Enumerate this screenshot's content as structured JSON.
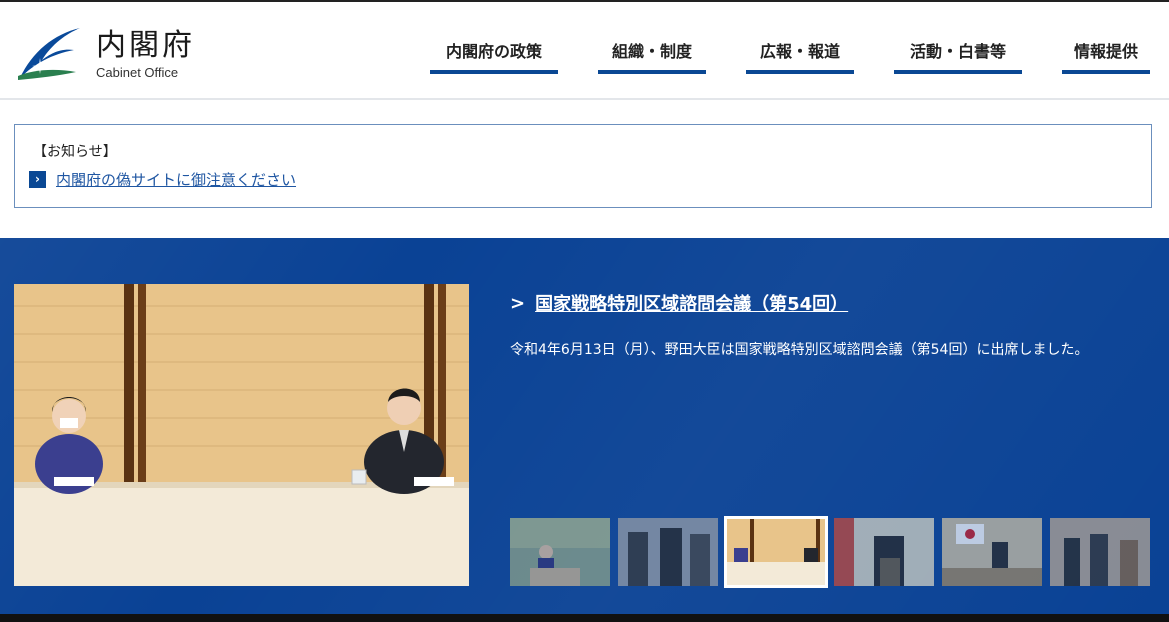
{
  "site": {
    "name_ja": "内閣府",
    "name_en": "Cabinet Office"
  },
  "nav": {
    "items": [
      {
        "label": "内閣府の政策"
      },
      {
        "label": "組織・制度"
      },
      {
        "label": "広報・報道"
      },
      {
        "label": "活動・白書等"
      },
      {
        "label": "情報提供"
      }
    ]
  },
  "notice": {
    "heading": "【お知らせ】",
    "link_text": "内閣府の偽サイトに御注意ください",
    "arrow": "›"
  },
  "feature": {
    "headline": "国家戦略特別区域諮問会議（第54回）",
    "chevron": ">",
    "description": "令和4年6月13日（月）、野田大臣は国家戦略特別区域諮問会議（第54回）に出席しました。",
    "thumbnail_count": 6,
    "active_thumbnail": 3
  },
  "colors": {
    "brand_blue": "#0a4295",
    "nav_underline": "#0a4894",
    "link": "#1f56a2"
  }
}
